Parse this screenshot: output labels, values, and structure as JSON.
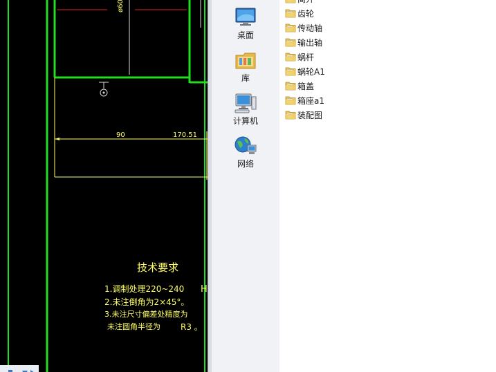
{
  "cad_drawing": {
    "background": "#000000",
    "frame_color": "#22dd22",
    "line_color": "#ffff66",
    "centerline_color": "#dd2222",
    "vertical_label": "ø60",
    "dimension_left": "90",
    "dimension_right": "170.51",
    "tech_title": "技术要求",
    "tech_lines": [
      "1.调制处理220~240",
      "2.未注倒角为2×45°。",
      "3.未注尺寸偏差处精度为",
      "未注圆角半径为",
      "R3 。"
    ],
    "tech_extra": "H"
  },
  "nav_pane": {
    "items": [
      {
        "label": "桌面",
        "icon": "desktop-icon"
      },
      {
        "label": "库",
        "icon": "library-icon"
      },
      {
        "label": "计算机",
        "icon": "computer-icon"
      },
      {
        "label": "网络",
        "icon": "network-icon"
      }
    ]
  },
  "file_list": {
    "items": [
      "简介",
      "齿轮",
      "传动轴",
      "输出轴",
      "蜗杆",
      "蜗轮A1",
      "箱盖",
      "箱座a1",
      "装配图"
    ],
    "icon": "folder-icon"
  }
}
